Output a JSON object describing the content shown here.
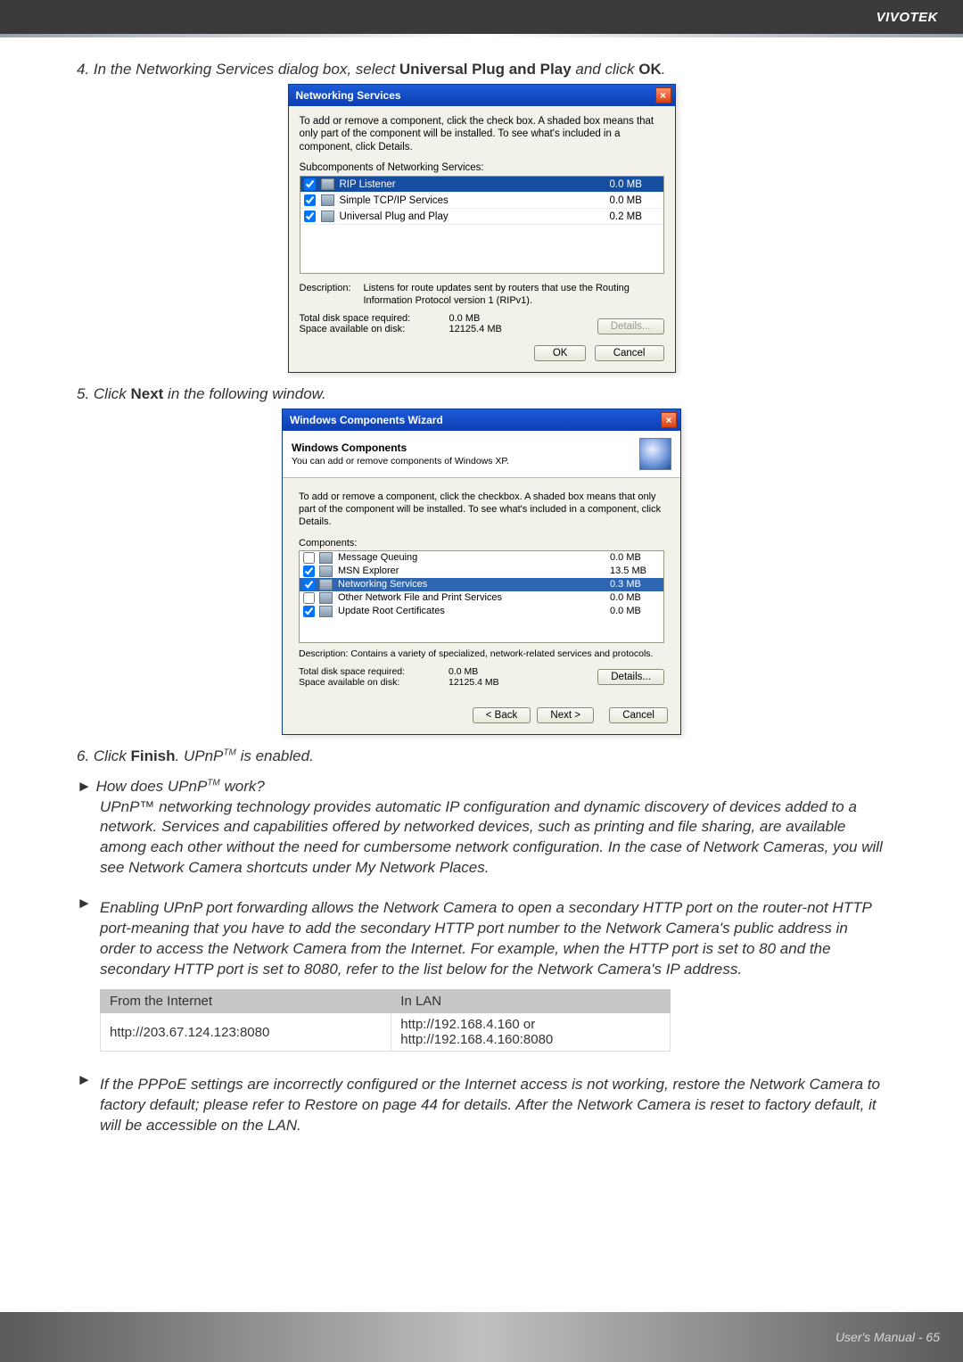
{
  "brand": "VIVOTEK",
  "footer": "User's Manual - 65",
  "step4": {
    "text_a": "4. In the Networking Services dialog box, select ",
    "b1": "Universal Plug and Play",
    "text_b": " and click ",
    "b2": "OK",
    "text_c": "."
  },
  "dlg1": {
    "title": "Networking Services",
    "intro": "To add or remove a component, click the check box. A shaded box means that only part of the component will be installed. To see what's included in a component, click Details.",
    "sublabel": "Subcomponents of Networking Services:",
    "items": [
      {
        "name": "RIP Listener",
        "size": "0.0 MB",
        "checked": true,
        "highlight": true
      },
      {
        "name": "Simple TCP/IP Services",
        "size": "0.0 MB",
        "checked": true,
        "highlight": false
      },
      {
        "name": "Universal Plug and Play",
        "size": "0.2 MB",
        "checked": true,
        "highlight": false
      }
    ],
    "desc_label": "Description:",
    "desc": "Listens for route updates sent by routers that use the Routing Information Protocol version 1 (RIPv1).",
    "req_label": "Total disk space required:",
    "req_val": "0.0 MB",
    "avail_label": "Space available on disk:",
    "avail_val": "12125.4 MB",
    "details_btn": "Details...",
    "ok_btn": "OK",
    "cancel_btn": "Cancel"
  },
  "step5": {
    "text_a": "5. Click ",
    "b": "Next",
    "text_b": " in the following window."
  },
  "dlg2": {
    "title": "Windows Components Wizard",
    "head_title": "Windows Components",
    "head_sub": "You can add or remove components of Windows XP.",
    "intro": "To add or remove a component, click the checkbox. A shaded box means that only part of the component will be installed. To see what's included in a component, click Details.",
    "comp_label": "Components:",
    "items": [
      {
        "name": "Message Queuing",
        "size": "0.0 MB",
        "checked": false,
        "highlight": false
      },
      {
        "name": "MSN Explorer",
        "size": "13.5 MB",
        "checked": true,
        "highlight": false
      },
      {
        "name": "Networking Services",
        "size": "0.3 MB",
        "checked": true,
        "highlight": true
      },
      {
        "name": "Other Network File and Print Services",
        "size": "0.0 MB",
        "checked": false,
        "highlight": false
      },
      {
        "name": "Update Root Certificates",
        "size": "0.0 MB",
        "checked": true,
        "highlight": false
      }
    ],
    "desc_label": "Description:",
    "desc": "Contains a variety of specialized, network-related services and protocols.",
    "req_label": "Total disk space required:",
    "req_val": "0.0 MB",
    "avail_label": "Space available on disk:",
    "avail_val": "12125.4 MB",
    "details_btn": "Details...",
    "back_btn": "< Back",
    "next_btn": "Next >",
    "cancel_btn": "Cancel"
  },
  "step6": {
    "text_a": "6. Click ",
    "b": "Finish",
    "text_b": ". UPnP",
    "tm": "TM",
    "text_c": " is enabled."
  },
  "q1": {
    "q": "How does UPnP",
    "tm": "TM",
    "q2": " work?",
    "p": "UPnP™ networking technology provides automatic IP configuration and dynamic discovery of devices added to a network. Services and capabilities offered by networked devices, such as printing and file sharing, are available among each other without the need for cumbersome network configuration. In the case of Network Cameras, you will see Network Camera shortcuts under My Network Places."
  },
  "p2": "Enabling UPnP port forwarding allows the Network Camera to open a secondary HTTP port on the router-not HTTP port-meaning that you have to add the secondary HTTP port number to the Network Camera's public address in order to access the Network Camera from the Internet. For example, when the HTTP port is set to 80 and the secondary HTTP port is set to 8080, refer to the list below for the Network Camera's IP address.",
  "table": {
    "h1": "From the Internet",
    "h2": "In LAN",
    "r1c1": "http://203.67.124.123:8080",
    "r1c2a": "http://192.168.4.160 or",
    "r1c2b": "http://192.168.4.160:8080"
  },
  "p3": "If the PPPoE settings are incorrectly configured or the Internet access is not working, restore the Network Camera to factory default; please refer to Restore on page 44 for details. After the Network Camera is reset to factory default, it will be accessible on the LAN."
}
